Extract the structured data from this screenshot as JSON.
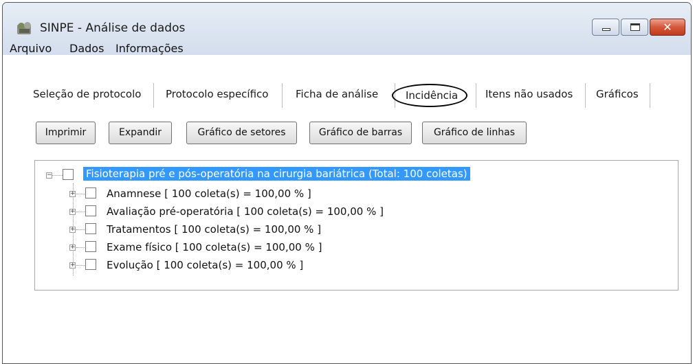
{
  "window": {
    "title": "SINPE - Análise de dados",
    "close_glyph": "✕"
  },
  "menu": [
    "Arquivo",
    "Dados",
    "Informações"
  ],
  "tabs": [
    "Seleção de protocolo",
    "Protocolo específico",
    "Ficha de análise",
    "Incidência",
    "Itens não usados",
    "Gráficos"
  ],
  "toolbar": {
    "print": "Imprimir",
    "expand": "Expandir",
    "pie_chart": "Gráfico de setores",
    "bar_chart": "Gráfico de barras",
    "line_chart": "Gráfico de linhas"
  },
  "tree": {
    "expander_expanded": "−",
    "expander_collapsed": "+",
    "root": "Fisioterapia pré e pós-operatória na cirurgia bariátrica (Total: 100 coletas)",
    "children": [
      "Anamnese    [ 100 coleta(s) = 100,00 % ]",
      "Avaliação pré-operatória    [ 100 coleta(s) = 100,00 % ]",
      "Tratamentos    [ 100 coleta(s) = 100,00 % ]",
      "Exame físico    [ 100 coleta(s) = 100,00 % ]",
      "Evolução    [ 100 coleta(s) = 100,00 % ]"
    ]
  },
  "colors": {
    "selection": "#3399ff",
    "close_button": "#c2391d"
  }
}
